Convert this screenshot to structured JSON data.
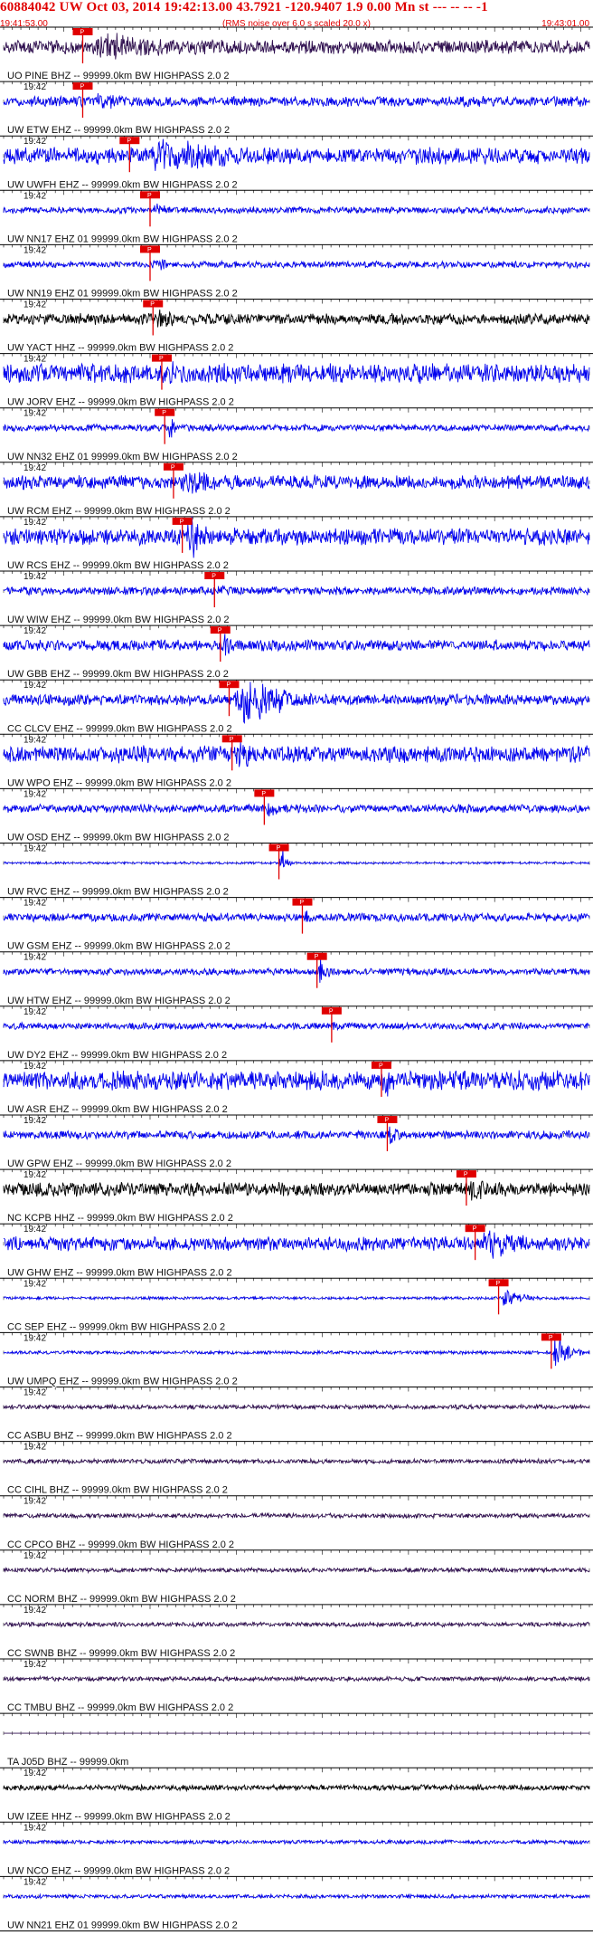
{
  "header": {
    "title": "60884042 UW Oct 03, 2014 19:42:13.00   43.7921 -120.9407  1.9 0.00 Mn st --- -- --   -1",
    "subtitle": "(RMS noise over 6.0 s scaled 20.0 x)",
    "start_time": "19:41:53.00",
    "end_time": "19:43:01.00"
  },
  "chart_data": {
    "type": "seismogram",
    "title": "60884042 UW Oct 03, 2014 19:42:13.00   43.7921 -120.9407  1.9 0.00 Mn st --- -- --   -1",
    "subtitle": "(RMS noise over 6.0 s scaled 20.0 x)",
    "x_range": [
      "19:41:53.00",
      "19:43:01.00"
    ],
    "time_label": "19:42",
    "pick_label": "P",
    "colors": {
      "header": "#e00000",
      "pick": "#e00000",
      "trace_blue": "#0000ee",
      "trace_black": "#000000",
      "trace_navy": "#301050",
      "grid": "#000000"
    },
    "traces": [
      {
        "label": "UO PINE BHZ -- 99999.0km BW  HIGHPASS  2.0  2",
        "time_label": "",
        "color": "navy",
        "pick": 0.135,
        "amp": 0.25,
        "event": 0.55,
        "event_start": 0.12,
        "event_end": 0.55
      },
      {
        "label": "UW ETW  EHZ -- 99999.0km BW  HIGHPASS  2.0  2",
        "time_label": "19:42",
        "color": "blue",
        "pick": 0.135,
        "amp": 0.18,
        "event": 0.35,
        "event_start": 0.14,
        "event_end": 0.3
      },
      {
        "label": "UW UWFH EHZ -- 99999.0km BW  HIGHPASS  2.0  2",
        "time_label": "19:42",
        "color": "blue",
        "pick": 0.215,
        "amp": 0.3,
        "event": 0.7,
        "event_start": 0.215,
        "event_end": 0.58
      },
      {
        "label": "UW NN17 EHZ 01 99999.0km BW  HIGHPASS  2.0  2",
        "time_label": "19:42",
        "color": "blue",
        "pick": 0.25,
        "amp": 0.12,
        "event": 0.3,
        "event_start": 0.25,
        "event_end": 0.32
      },
      {
        "label": "UW NN19 EHZ 01 99999.0km BW  HIGHPASS  2.0  2",
        "time_label": "19:42",
        "color": "blue",
        "pick": 0.25,
        "amp": 0.12,
        "event": 0.3,
        "event_start": 0.25,
        "event_end": 0.32
      },
      {
        "label": "UW YACT HHZ -- 99999.0km BW  HIGHPASS  2.0  2",
        "time_label": "19:42",
        "color": "black",
        "pick": 0.255,
        "amp": 0.2,
        "event": 0.45,
        "event_start": 0.255,
        "event_end": 0.34
      },
      {
        "label": "UW JORV EHZ -- 99999.0km BW  HIGHPASS  2.0  2",
        "time_label": "19:42",
        "color": "blue",
        "pick": 0.27,
        "amp": 0.35,
        "event": 0.5,
        "event_start": 0.27,
        "event_end": 0.37
      },
      {
        "label": "UW NN32 EHZ 01 99999.0km BW  HIGHPASS  2.0  2",
        "time_label": "19:42",
        "color": "blue",
        "pick": 0.275,
        "amp": 0.12,
        "event": 0.5,
        "event_start": 0.28,
        "event_end": 0.31
      },
      {
        "label": "UW RCM  EHZ -- 99999.0km BW  HIGHPASS  2.0  2",
        "time_label": "19:42",
        "color": "blue",
        "pick": 0.29,
        "amp": 0.25,
        "event": 0.6,
        "event_start": 0.29,
        "event_end": 0.44
      },
      {
        "label": "UW RCS  EHZ -- 99999.0km BW  HIGHPASS  2.0  2",
        "time_label": "19:42",
        "color": "blue",
        "pick": 0.305,
        "amp": 0.3,
        "event": 0.85,
        "event_start": 0.305,
        "event_end": 0.4
      },
      {
        "label": "UW WIW  EHZ -- 99999.0km BW  HIGHPASS  2.0  2",
        "time_label": "19:42",
        "color": "blue",
        "pick": 0.36,
        "amp": 0.15,
        "event": 0.3,
        "event_start": 0.36,
        "event_end": 0.4
      },
      {
        "label": "UW GBB  EHZ -- 99999.0km BW  HIGHPASS  2.0  2",
        "time_label": "19:42",
        "color": "blue",
        "pick": 0.37,
        "amp": 0.2,
        "event": 0.45,
        "event_start": 0.37,
        "event_end": 0.42
      },
      {
        "label": "CC CLCV EHZ -- 99999.0km BW  HIGHPASS  2.0  2",
        "time_label": "19:42",
        "color": "blue",
        "pick": 0.385,
        "amp": 0.2,
        "event": 0.95,
        "event_start": 0.385,
        "event_end": 0.56
      },
      {
        "label": "UW WPO  EHZ -- 99999.0km BW  HIGHPASS  2.0  2",
        "time_label": "19:42",
        "color": "blue",
        "pick": 0.39,
        "amp": 0.3,
        "event": 0.6,
        "event_start": 0.39,
        "event_end": 0.48
      },
      {
        "label": "UW OSD  EHZ -- 99999.0km BW  HIGHPASS  2.0  2",
        "time_label": "19:42",
        "color": "blue",
        "pick": 0.445,
        "amp": 0.15,
        "event": 0.4,
        "event_start": 0.445,
        "event_end": 0.49
      },
      {
        "label": "UW RVC  EHZ -- 99999.0km BW  HIGHPASS  2.0  2",
        "time_label": "19:42",
        "color": "blue",
        "pick": 0.47,
        "amp": 0.04,
        "event": 0.75,
        "event_start": 0.47,
        "event_end": 0.49
      },
      {
        "label": "UW GSM  EHZ -- 99999.0km BW  HIGHPASS  2.0  2",
        "time_label": "19:42",
        "color": "blue",
        "pick": 0.51,
        "amp": 0.15,
        "event": 0.4,
        "event_start": 0.51,
        "event_end": 0.54
      },
      {
        "label": "UW HTW  EHZ -- 99999.0km BW  HIGHPASS  2.0  2",
        "time_label": "19:42",
        "color": "blue",
        "pick": 0.535,
        "amp": 0.12,
        "event": 0.6,
        "event_start": 0.535,
        "event_end": 0.57
      },
      {
        "label": "UW DY2  EHZ -- 99999.0km BW  HIGHPASS  2.0  2",
        "time_label": "19:42",
        "color": "blue",
        "pick": 0.56,
        "amp": 0.12,
        "event": 0.2,
        "event_start": 0.56,
        "event_end": 0.58
      },
      {
        "label": "UW ASR  EHZ -- 99999.0km BW  HIGHPASS  2.0  2",
        "time_label": "19:42",
        "color": "blue",
        "pick": 0.645,
        "amp": 0.35,
        "event": 0.6,
        "event_start": 0.645,
        "event_end": 0.7
      },
      {
        "label": "UW GPW  EHZ -- 99999.0km BW  HIGHPASS  2.0  2",
        "time_label": "19:42",
        "color": "blue",
        "pick": 0.655,
        "amp": 0.15,
        "event": 0.45,
        "event_start": 0.655,
        "event_end": 0.69
      },
      {
        "label": "NC KCPB HHZ -- 99999.0km BW  HIGHPASS  2.0  2",
        "time_label": "19:42",
        "color": "black",
        "pick": 0.79,
        "amp": 0.25,
        "event": 0.6,
        "event_start": 0.79,
        "event_end": 0.87
      },
      {
        "label": "UW GHW  EHZ -- 99999.0km BW  HIGHPASS  2.0  2",
        "time_label": "19:42",
        "color": "blue",
        "pick": 0.805,
        "amp": 0.25,
        "event": 0.6,
        "event_start": 0.8,
        "event_end": 0.99
      },
      {
        "label": "CC SEP  EHZ -- 99999.0km BW  HIGHPASS  2.0  2",
        "time_label": "19:42",
        "color": "blue",
        "pick": 0.845,
        "amp": 0.05,
        "event": 0.35,
        "event_start": 0.845,
        "event_end": 0.92
      },
      {
        "label": "UW UMPQ EHZ -- 99999.0km BW  HIGHPASS  2.0  2",
        "time_label": "19:42",
        "color": "blue",
        "pick": 0.935,
        "amp": 0.06,
        "event": 0.7,
        "event_start": 0.935,
        "event_end": 0.99
      },
      {
        "label": "CC ASBU BHZ -- 99999.0km BW  HIGHPASS  2.0  2",
        "time_label": "19:42",
        "color": "navy",
        "pick": null,
        "amp": 0.08,
        "event": 0
      },
      {
        "label": "CC CIHL BHZ -- 99999.0km BW  HIGHPASS  2.0  2",
        "time_label": "19:42",
        "color": "navy",
        "pick": null,
        "amp": 0.08,
        "event": 0
      },
      {
        "label": "CC CPCO BHZ -- 99999.0km BW  HIGHPASS  2.0  2",
        "time_label": "19:42",
        "color": "navy",
        "pick": null,
        "amp": 0.08,
        "event": 0
      },
      {
        "label": "CC NORM BHZ -- 99999.0km BW  HIGHPASS  2.0  2",
        "time_label": "19:42",
        "color": "navy",
        "pick": null,
        "amp": 0.08,
        "event": 0
      },
      {
        "label": "CC SWNB BHZ -- 99999.0km BW  HIGHPASS  2.0  2",
        "time_label": "19:42",
        "color": "navy",
        "pick": null,
        "amp": 0.08,
        "event": 0
      },
      {
        "label": "CC TMBU BHZ -- 99999.0km BW  HIGHPASS  2.0  2",
        "time_label": "19:42",
        "color": "navy",
        "pick": null,
        "amp": 0.08,
        "event": 0
      },
      {
        "label": "TA J05D BHZ -- 99999.0km",
        "time_label": "",
        "color": "navy",
        "pick": null,
        "amp": 0.0,
        "event": 0
      },
      {
        "label": "UW IZEE HHZ -- 99999.0km BW  HIGHPASS  2.0  2",
        "time_label": "19:42",
        "color": "black",
        "pick": null,
        "amp": 0.1,
        "event": 0
      },
      {
        "label": "UW NCO  EHZ -- 99999.0km BW  HIGHPASS  2.0  2",
        "time_label": "19:42",
        "color": "blue",
        "pick": null,
        "amp": 0.07,
        "event": 0
      },
      {
        "label": "UW NN21 EHZ 01 99999.0km BW  HIGHPASS  2.0  2",
        "time_label": "19:42",
        "color": "blue",
        "pick": null,
        "amp": 0.07,
        "event": 0
      }
    ]
  }
}
